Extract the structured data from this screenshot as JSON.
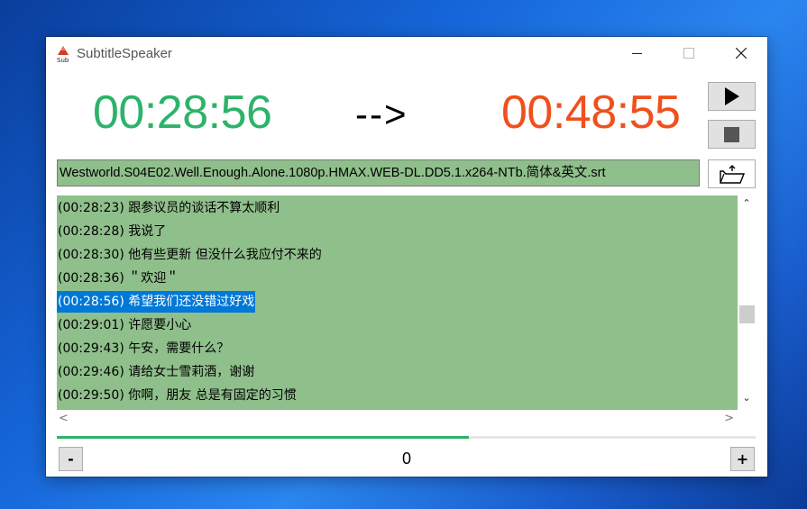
{
  "window": {
    "title": "SubtitleSpeaker",
    "app_icon": "sub-icon"
  },
  "times": {
    "start": "00:28:56",
    "arrow": "-->",
    "end": "00:48:55"
  },
  "controls": {
    "play_icon": "play-icon",
    "stop_icon": "stop-icon",
    "open_icon": "folder-open-icon"
  },
  "file": {
    "name": "Westworld.S04E02.Well.Enough.Alone.1080p.HMAX.WEB-DL.DD5.1.x264-NTb.简体&英文.srt"
  },
  "subtitles": [
    {
      "text": "(00:28:23)  跟参议员的谈话不算太顺利",
      "selected": false
    },
    {
      "text": "(00:28:28)  我说了",
      "selected": false
    },
    {
      "text": "(00:28:30)  他有些更新 但没什么我应付不来的",
      "selected": false
    },
    {
      "text": "(00:28:36)  ＂欢迎＂",
      "selected": false
    },
    {
      "text": "(00:28:56)  希望我们还没错过好戏",
      "selected": true
    },
    {
      "text": "(00:29:01)  许愿要小心",
      "selected": false
    },
    {
      "text": "(00:29:43)  午安，需要什么？",
      "selected": false
    },
    {
      "text": "(00:29:46)  请给女士雪莉酒，谢谢",
      "selected": false
    },
    {
      "text": "(00:29:50)  你啊，朋友 总是有固定的习惯",
      "selected": false
    }
  ],
  "progress": {
    "fraction": 0.59
  },
  "offset": {
    "minus_label": "-",
    "value": "0",
    "plus_label": "+"
  },
  "colors": {
    "start_time": "#2db36a",
    "end_time": "#f0501c",
    "list_bg": "#8fbf8b",
    "selection": "#0078d7"
  }
}
